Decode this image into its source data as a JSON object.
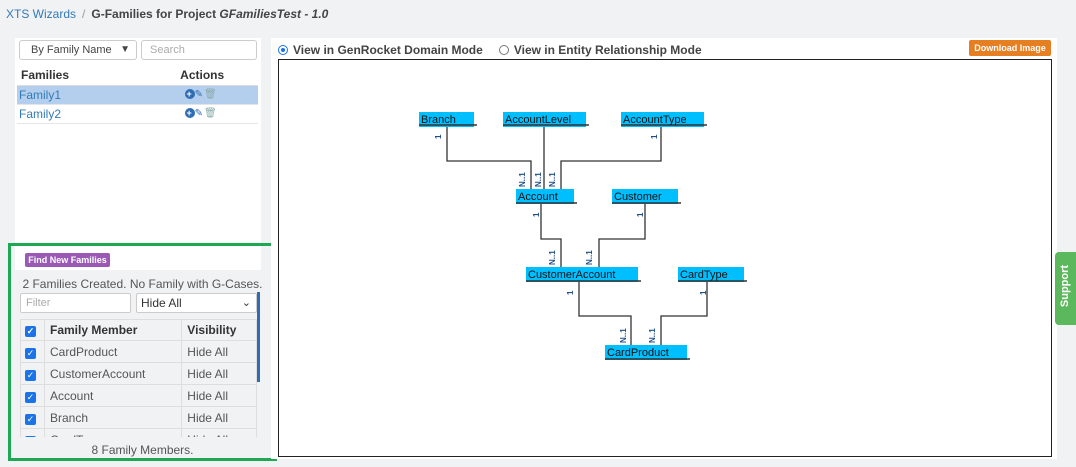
{
  "breadcrumb": {
    "link": "XTS Wizards",
    "separator": "/",
    "title_prefix": "G-Families for Project",
    "project": "GFamiliesTest - 1.0"
  },
  "family_panel": {
    "sort_select": "By Family Name",
    "search_placeholder": "Search",
    "headers": {
      "families": "Families",
      "actions": "Actions"
    },
    "rows": [
      {
        "name": "Family1",
        "selected": true
      },
      {
        "name": "Family2",
        "selected": false
      }
    ]
  },
  "members_panel": {
    "find_button": "Find New Families",
    "status": "2 Families Created. No Family with G-Cases.",
    "filter_placeholder": "Filter",
    "visibility_select": "Hide All",
    "headers": {
      "member": "Family Member",
      "visibility": "Visibility"
    },
    "rows": [
      {
        "name": "CardProduct",
        "visibility": "Hide All",
        "checked": true
      },
      {
        "name": "CustomerAccount",
        "visibility": "Hide All",
        "checked": true
      },
      {
        "name": "Account",
        "visibility": "Hide All",
        "checked": true
      },
      {
        "name": "Branch",
        "visibility": "Hide All",
        "checked": true
      },
      {
        "name": "CardType",
        "visibility": "Hide All",
        "checked": true
      }
    ],
    "count": "8 Family Members."
  },
  "view_modes": {
    "domain_mode": "View in GenRocket Domain Mode",
    "er_mode": "View in Entity Relationship Mode",
    "selected": "domain_mode"
  },
  "download_button": "Download Image",
  "diagram": {
    "node_color": "#00bfff",
    "nodes": [
      "Branch",
      "AccountLevel",
      "AccountType",
      "Account",
      "Customer",
      "CustomerAccount",
      "CardType",
      "CardProduct"
    ],
    "labels": {
      "one": "1",
      "many": "N..1"
    }
  },
  "support_tab": "Support",
  "colors": {
    "annotation_green": "#1ea853",
    "find_button": "#9b59b6",
    "download_button": "#e67e22",
    "support_tab": "#5cb85c",
    "link": "#337ab7"
  }
}
